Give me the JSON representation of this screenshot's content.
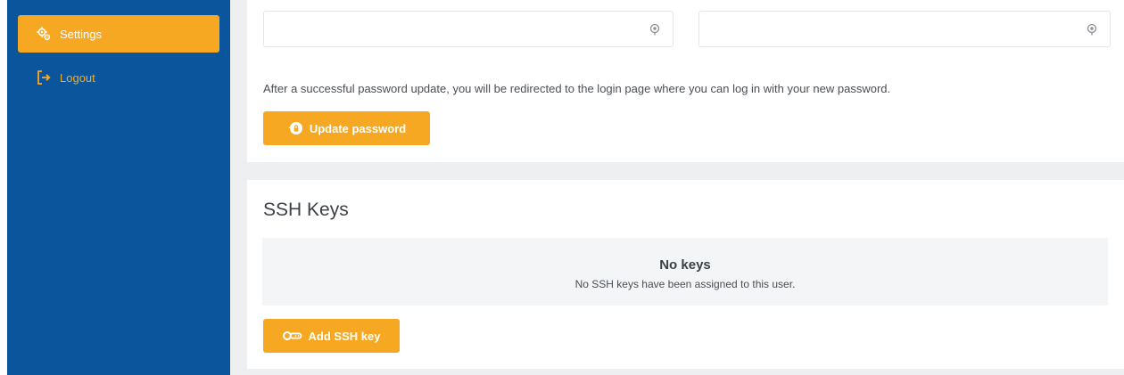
{
  "sidebar": {
    "items": [
      {
        "label": "Settings",
        "icon": "gear-icon",
        "active": true
      },
      {
        "label": "Logout",
        "icon": "logout-icon",
        "active": false
      }
    ]
  },
  "password": {
    "field_one_value": "",
    "field_two_value": "",
    "info": "After a successful password update, you will be redirected to the login page where you can log in with your new password.",
    "update_label": "Update password"
  },
  "ssh": {
    "title": "SSH Keys",
    "empty_title": "No keys",
    "empty_desc": "No SSH keys have been assigned to this user.",
    "add_label": "Add SSH key"
  },
  "colors": {
    "sidebar": "#0a559c",
    "accent": "#f7a823",
    "background": "#eeeff1"
  }
}
